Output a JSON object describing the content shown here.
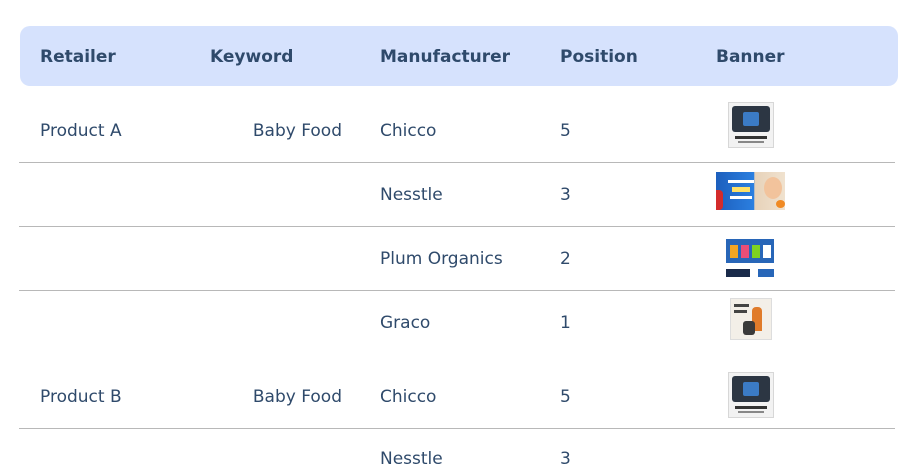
{
  "table": {
    "headers": {
      "retailer": "Retailer",
      "keyword": "Keyword",
      "manufacturer": "Manufacturer",
      "position": "Position",
      "banner": "Banner"
    },
    "rows": [
      {
        "retailer": "Product A",
        "keyword": "Baby Food",
        "manufacturer": "Chicco",
        "position": "5",
        "banner_icon": "chicco-banner-image"
      },
      {
        "retailer": "",
        "keyword": "",
        "manufacturer": "Nesstle",
        "position": "3",
        "banner_icon": "nestle-banner-image"
      },
      {
        "retailer": "",
        "keyword": "",
        "manufacturer": "Plum Organics",
        "position": "2",
        "banner_icon": "plum-organics-banner-image"
      },
      {
        "retailer": "",
        "keyword": "",
        "manufacturer": "Graco",
        "position": "1",
        "banner_icon": "graco-banner-image"
      },
      {
        "retailer": "Product B",
        "keyword": "Baby Food",
        "manufacturer": "Chicco",
        "position": "5",
        "banner_icon": "chicco-banner-image"
      },
      {
        "retailer": "",
        "keyword": "",
        "manufacturer": "Nesstle",
        "position": "3",
        "banner_icon": "nestle-banner-image"
      }
    ]
  },
  "colors": {
    "header_background": "#d6e2fd",
    "text": "#2f4a6b",
    "separator": "#b8b8b8"
  }
}
